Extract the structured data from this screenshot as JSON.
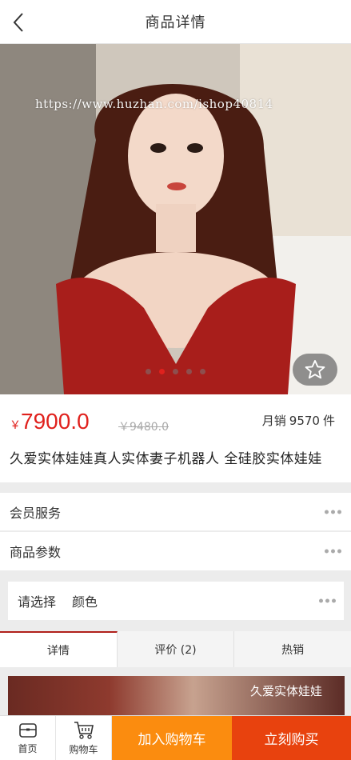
{
  "header": {
    "title": "商品详情"
  },
  "hero": {
    "watermark": "https://www.huzhan.com/ishop40814",
    "slide_count": 5,
    "active_slide": 1
  },
  "product": {
    "currency": "￥",
    "price": "7900.0",
    "old_price": "￥9480.0",
    "sales_label": "月销",
    "sales_count": "9570",
    "sales_unit": "件",
    "title": "久爱实体娃娃真人实体妻子机器人 全硅胶实体娃娃"
  },
  "rows": {
    "member_service": "会员服务",
    "product_params": "商品参数"
  },
  "select": {
    "label": "请选择",
    "option": "颜色"
  },
  "tabs": [
    "详情",
    "评价 (2)",
    "热销"
  ],
  "detail": {
    "brand_text": "久爱实体娃娃"
  },
  "bottom": {
    "home": "首页",
    "cart": "购物车",
    "add_to_cart": "加入购物车",
    "buy_now": "立刻购买"
  },
  "colors": {
    "accent_red": "#e0211d",
    "cart_orange": "#fb8c0f",
    "buy_red": "#e8420e"
  }
}
